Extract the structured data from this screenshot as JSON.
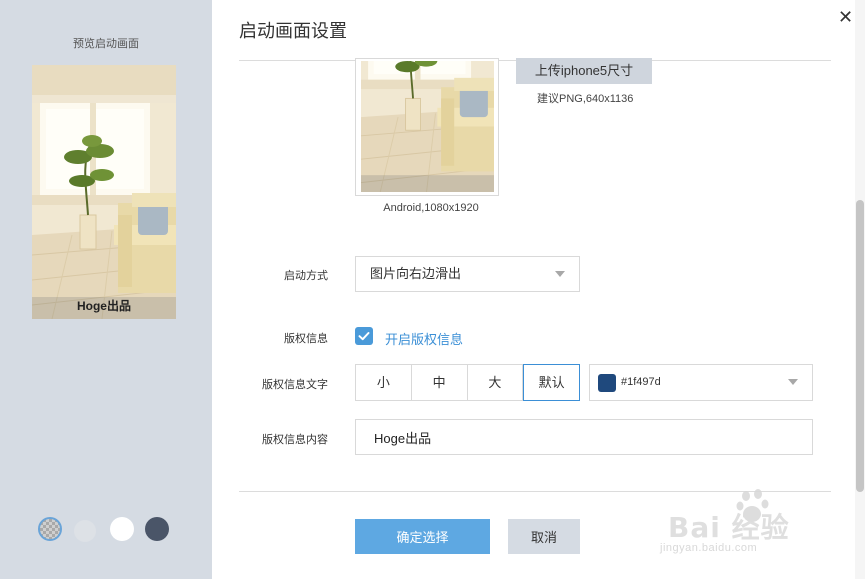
{
  "dialog": {
    "title": "启动画面设置",
    "close_symbol": "✕"
  },
  "preview": {
    "title": "预览启动画面",
    "credit_text": "Hoge出品",
    "swatches": [
      {
        "name": "transparent",
        "color": "checker"
      },
      {
        "name": "light-gray",
        "color": "#dde1e6"
      },
      {
        "name": "white",
        "color": "#ffffff"
      },
      {
        "name": "dark",
        "color": "#4a5568"
      }
    ]
  },
  "upload": {
    "android_caption": "Android,1080x1920",
    "iphone5_button": "上传iphone5尺寸",
    "iphone5_hint": "建议PNG,640x1136"
  },
  "form": {
    "launch_mode": {
      "label": "启动方式",
      "value": "图片向右边滑出"
    },
    "copyright": {
      "label": "版权信息",
      "checkbox_label": "开启版权信息",
      "checked": true
    },
    "copyright_text": {
      "label": "版权信息文字",
      "sizes": [
        "小",
        "中",
        "大",
        "默认"
      ],
      "selected_size": "默认",
      "color_value": "#1f497d",
      "color_hex": "#1f497d"
    },
    "copyright_content": {
      "label": "版权信息内容",
      "value": "Hoge出品"
    }
  },
  "buttons": {
    "confirm": "确定选择",
    "cancel": "取消"
  },
  "watermark": {
    "brand": "Bai  经验",
    "url": "jingyan.baidu.com"
  },
  "colors": {
    "accent": "#3b8fd6",
    "primary_button": "#5ea8e2",
    "panel_bg": "#d5dbe3"
  }
}
